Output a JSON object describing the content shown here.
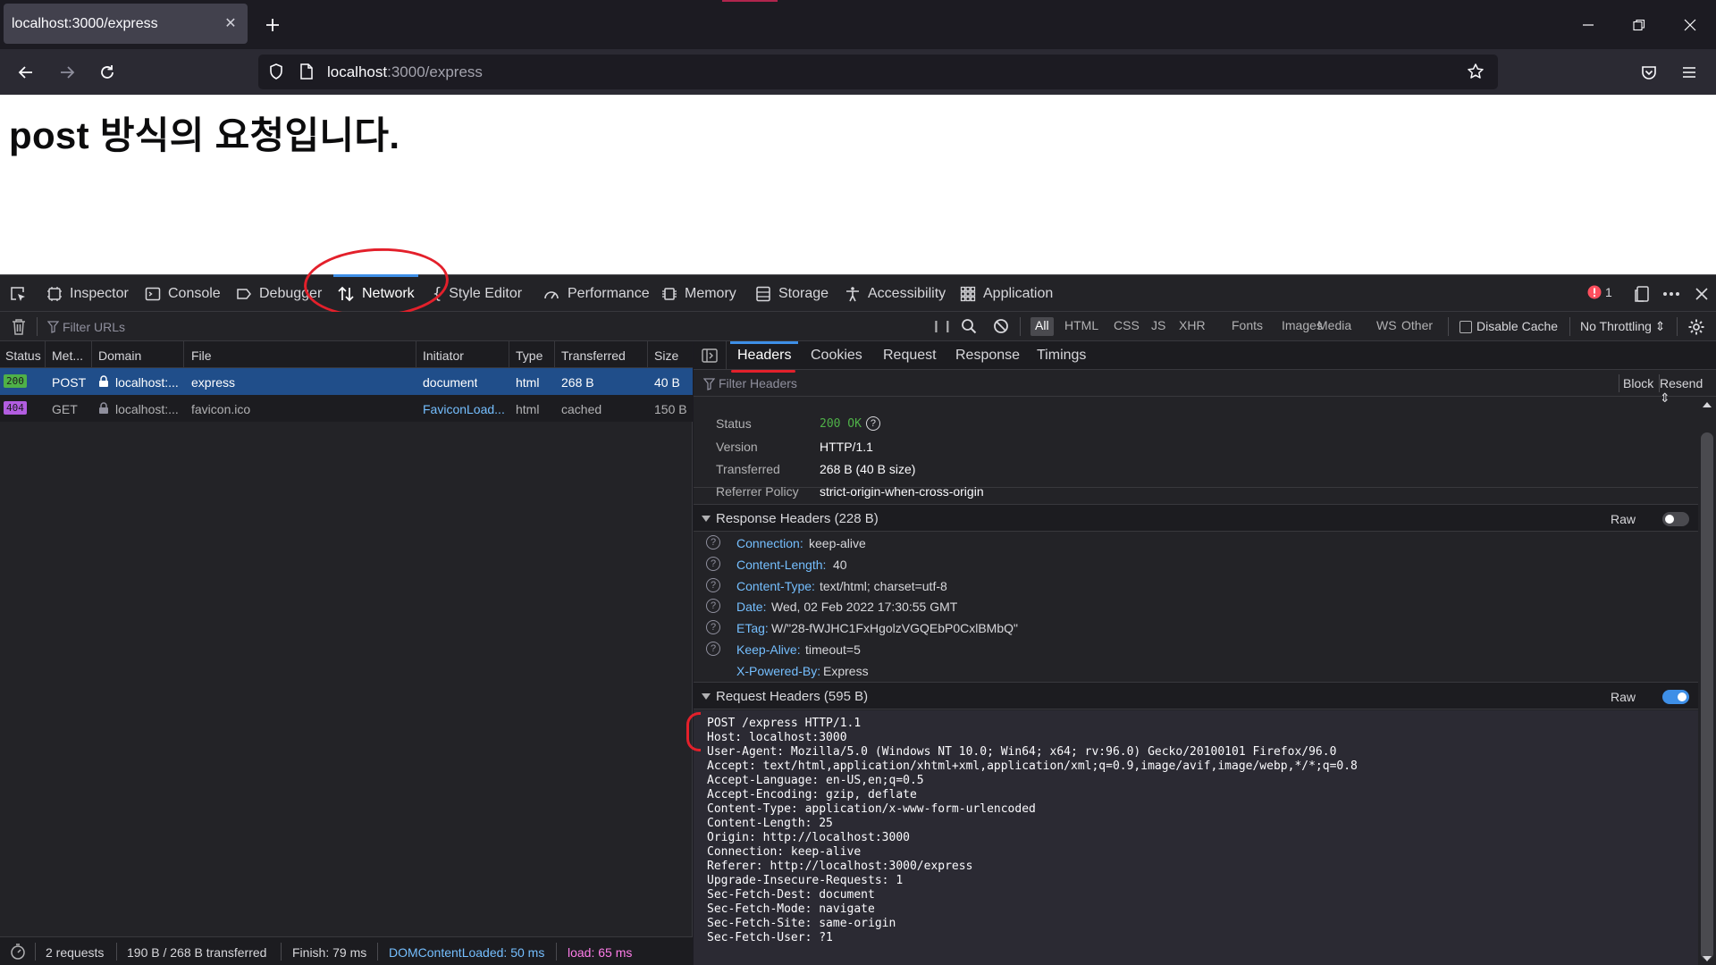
{
  "browser": {
    "tab_title": "localhost:3000/express",
    "url_host": "localhost",
    "url_rest": ":3000/express"
  },
  "page": {
    "heading": "post 방식의 요청입니다."
  },
  "devtools": {
    "tabs": [
      {
        "label": "Inspector",
        "icon": "inspector-icon"
      },
      {
        "label": "Console",
        "icon": "console-icon"
      },
      {
        "label": "Debugger",
        "icon": "debugger-icon"
      },
      {
        "label": "Network",
        "icon": "network-icon"
      },
      {
        "label": "Style Editor",
        "icon": "style-editor-icon"
      },
      {
        "label": "Performance",
        "icon": "performance-icon"
      },
      {
        "label": "Memory",
        "icon": "memory-icon"
      },
      {
        "label": "Storage",
        "icon": "storage-icon"
      },
      {
        "label": "Accessibility",
        "icon": "accessibility-icon"
      },
      {
        "label": "Application",
        "icon": "application-icon"
      }
    ],
    "error_count": "1",
    "filter_placeholder": "Filter URLs",
    "type_filters": [
      "All",
      "HTML",
      "CSS",
      "JS",
      "XHR",
      "Fonts",
      "Images",
      "Media",
      "WS",
      "Other"
    ],
    "disable_cache_label": "Disable Cache",
    "throttling_label": "No Throttling ⇕",
    "columns": [
      "Status",
      "Met...",
      "Domain",
      "File",
      "Initiator",
      "Type",
      "Transferred",
      "Size"
    ],
    "requests": [
      {
        "status": "200",
        "method": "POST",
        "domain": "localhost:...",
        "file": "express",
        "initiator": "document",
        "type": "html",
        "transferred": "268 B",
        "size": "40 B"
      },
      {
        "status": "404",
        "method": "GET",
        "domain": "localhost:...",
        "file": "favicon.ico",
        "initiator": "FaviconLoad...",
        "type": "html",
        "transferred": "cached",
        "size": "150 B"
      }
    ],
    "statusbar": {
      "requests": "2 requests",
      "transferred": "190 B / 268 B transferred",
      "finish": "Finish: 79 ms",
      "dom": "DOMContentLoaded: 50 ms",
      "load": "load: 65 ms"
    },
    "detail_tabs": [
      "Headers",
      "Cookies",
      "Request",
      "Response",
      "Timings"
    ],
    "headers_filter_placeholder": "Filter Headers",
    "block_label": "Block",
    "resend_label": "Resend ⇕",
    "summary": [
      {
        "k": "Status",
        "v": "200 OK"
      },
      {
        "k": "Version",
        "v": "HTTP/1.1"
      },
      {
        "k": "Transferred",
        "v": "268 B (40 B size)"
      },
      {
        "k": "Referrer Policy",
        "v": "strict-origin-when-cross-origin"
      }
    ],
    "response_headers_title": "Response Headers (228 B)",
    "raw_label": "Raw",
    "response_headers": [
      {
        "name": "Connection:",
        "value": "keep-alive"
      },
      {
        "name": "Content-Length:",
        "value": "40"
      },
      {
        "name": "Content-Type:",
        "value": "text/html; charset=utf-8"
      },
      {
        "name": "Date:",
        "value": "Wed, 02 Feb 2022 17:30:55 GMT"
      },
      {
        "name": "ETag:",
        "value": "W/\"28-fWJHC1FxHgolzVGQEbP0CxlBMbQ\""
      },
      {
        "name": "Keep-Alive:",
        "value": "timeout=5"
      },
      {
        "name": "X-Powered-By:",
        "value": "Express"
      }
    ],
    "request_headers_title": "Request Headers (595 B)",
    "request_raw": "POST /express HTTP/1.1\nHost: localhost:3000\nUser-Agent: Mozilla/5.0 (Windows NT 10.0; Win64; x64; rv:96.0) Gecko/20100101 Firefox/96.0\nAccept: text/html,application/xhtml+xml,application/xml;q=0.9,image/avif,image/webp,*/*;q=0.8\nAccept-Language: en-US,en;q=0.5\nAccept-Encoding: gzip, deflate\nContent-Type: application/x-www-form-urlencoded\nContent-Length: 25\nOrigin: http://localhost:3000\nConnection: keep-alive\nReferer: http://localhost:3000/express\nUpgrade-Insecure-Requests: 1\nSec-Fetch-Dest: document\nSec-Fetch-Mode: navigate\nSec-Fetch-Site: same-origin\nSec-Fetch-User: ?1"
  },
  "colors": {
    "status_200": "#4fb148",
    "status_404": "#b25de0",
    "accent": "#3e8fe7",
    "annotation": "#e3202b"
  }
}
